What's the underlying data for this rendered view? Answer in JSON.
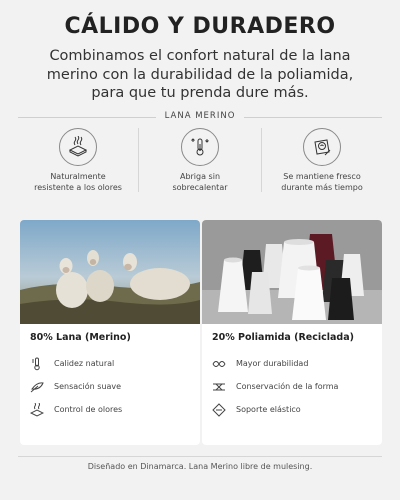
{
  "header": {
    "title": "CÁLIDO Y DURADERO",
    "subtitle": "Combinamos el confort natural de la lana merino con la durabilidad de la poliamida, para que tu prenda dure más."
  },
  "section": {
    "label": "LANA MERINO"
  },
  "features": [
    {
      "icon": "fabric-waves-icon",
      "label": "Naturalmente\nresistente a los olores"
    },
    {
      "icon": "thermometer-arrows-icon",
      "label": "Abriga sin\nsobrecalentar"
    },
    {
      "icon": "cool-fabric-icon",
      "label": "Se mantiene fresco\ndurante más tiempo"
    }
  ],
  "cards": [
    {
      "title": "80% Lana (Merino)",
      "image": "sheep-photo",
      "items": [
        {
          "icon": "thermometer-icon",
          "label": "Calidez natural"
        },
        {
          "icon": "feather-icon",
          "label": "Sensación suave"
        },
        {
          "icon": "odor-control-icon",
          "label": "Control de olores"
        }
      ]
    },
    {
      "title": "20% Poliamida (Reciclada)",
      "image": "thread-spools-photo",
      "items": [
        {
          "icon": "durability-icon",
          "label": "Mayor durabilidad"
        },
        {
          "icon": "shape-retention-icon",
          "label": "Conservación de la forma"
        },
        {
          "icon": "elastic-support-icon",
          "label": "Soporte elástico"
        }
      ]
    }
  ],
  "footer": {
    "text": "Diseñado en Dinamarca. Lana Merino libre de mulesing."
  }
}
